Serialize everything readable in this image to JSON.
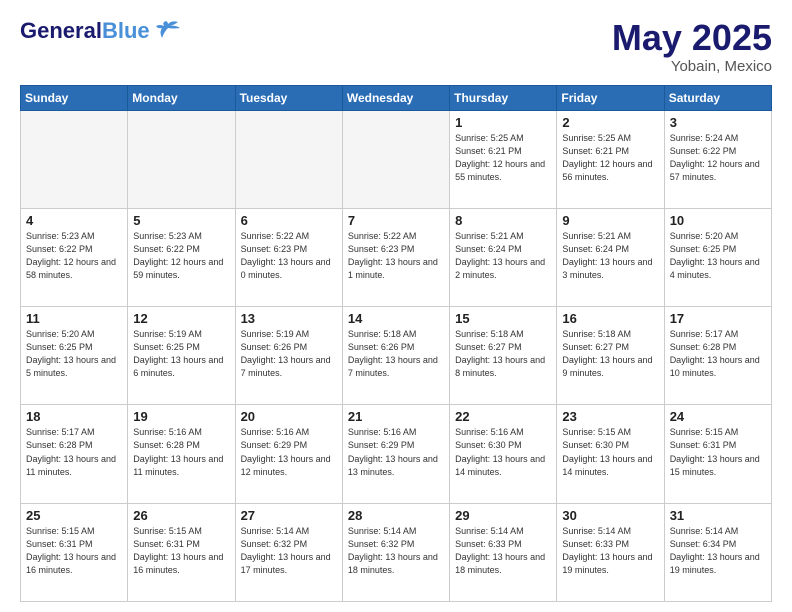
{
  "header": {
    "logo_line1a": "General",
    "logo_line1b": "Blue",
    "main_title": "May 2025",
    "subtitle": "Yobain, Mexico"
  },
  "days_of_week": [
    "Sunday",
    "Monday",
    "Tuesday",
    "Wednesday",
    "Thursday",
    "Friday",
    "Saturday"
  ],
  "weeks": [
    [
      {
        "day": "",
        "empty": true
      },
      {
        "day": "",
        "empty": true
      },
      {
        "day": "",
        "empty": true
      },
      {
        "day": "",
        "empty": true
      },
      {
        "day": "1",
        "sunrise": "5:25 AM",
        "sunset": "6:21 PM",
        "daylight": "12 hours and 55 minutes."
      },
      {
        "day": "2",
        "sunrise": "5:25 AM",
        "sunset": "6:21 PM",
        "daylight": "12 hours and 56 minutes."
      },
      {
        "day": "3",
        "sunrise": "5:24 AM",
        "sunset": "6:22 PM",
        "daylight": "12 hours and 57 minutes."
      }
    ],
    [
      {
        "day": "4",
        "sunrise": "5:23 AM",
        "sunset": "6:22 PM",
        "daylight": "12 hours and 58 minutes."
      },
      {
        "day": "5",
        "sunrise": "5:23 AM",
        "sunset": "6:22 PM",
        "daylight": "12 hours and 59 minutes."
      },
      {
        "day": "6",
        "sunrise": "5:22 AM",
        "sunset": "6:23 PM",
        "daylight": "13 hours and 0 minutes."
      },
      {
        "day": "7",
        "sunrise": "5:22 AM",
        "sunset": "6:23 PM",
        "daylight": "13 hours and 1 minute."
      },
      {
        "day": "8",
        "sunrise": "5:21 AM",
        "sunset": "6:24 PM",
        "daylight": "13 hours and 2 minutes."
      },
      {
        "day": "9",
        "sunrise": "5:21 AM",
        "sunset": "6:24 PM",
        "daylight": "13 hours and 3 minutes."
      },
      {
        "day": "10",
        "sunrise": "5:20 AM",
        "sunset": "6:25 PM",
        "daylight": "13 hours and 4 minutes."
      }
    ],
    [
      {
        "day": "11",
        "sunrise": "5:20 AM",
        "sunset": "6:25 PM",
        "daylight": "13 hours and 5 minutes."
      },
      {
        "day": "12",
        "sunrise": "5:19 AM",
        "sunset": "6:25 PM",
        "daylight": "13 hours and 6 minutes."
      },
      {
        "day": "13",
        "sunrise": "5:19 AM",
        "sunset": "6:26 PM",
        "daylight": "13 hours and 7 minutes."
      },
      {
        "day": "14",
        "sunrise": "5:18 AM",
        "sunset": "6:26 PM",
        "daylight": "13 hours and 7 minutes."
      },
      {
        "day": "15",
        "sunrise": "5:18 AM",
        "sunset": "6:27 PM",
        "daylight": "13 hours and 8 minutes."
      },
      {
        "day": "16",
        "sunrise": "5:18 AM",
        "sunset": "6:27 PM",
        "daylight": "13 hours and 9 minutes."
      },
      {
        "day": "17",
        "sunrise": "5:17 AM",
        "sunset": "6:28 PM",
        "daylight": "13 hours and 10 minutes."
      }
    ],
    [
      {
        "day": "18",
        "sunrise": "5:17 AM",
        "sunset": "6:28 PM",
        "daylight": "13 hours and 11 minutes."
      },
      {
        "day": "19",
        "sunrise": "5:16 AM",
        "sunset": "6:28 PM",
        "daylight": "13 hours and 11 minutes."
      },
      {
        "day": "20",
        "sunrise": "5:16 AM",
        "sunset": "6:29 PM",
        "daylight": "13 hours and 12 minutes."
      },
      {
        "day": "21",
        "sunrise": "5:16 AM",
        "sunset": "6:29 PM",
        "daylight": "13 hours and 13 minutes."
      },
      {
        "day": "22",
        "sunrise": "5:16 AM",
        "sunset": "6:30 PM",
        "daylight": "13 hours and 14 minutes."
      },
      {
        "day": "23",
        "sunrise": "5:15 AM",
        "sunset": "6:30 PM",
        "daylight": "13 hours and 14 minutes."
      },
      {
        "day": "24",
        "sunrise": "5:15 AM",
        "sunset": "6:31 PM",
        "daylight": "13 hours and 15 minutes."
      }
    ],
    [
      {
        "day": "25",
        "sunrise": "5:15 AM",
        "sunset": "6:31 PM",
        "daylight": "13 hours and 16 minutes."
      },
      {
        "day": "26",
        "sunrise": "5:15 AM",
        "sunset": "6:31 PM",
        "daylight": "13 hours and 16 minutes."
      },
      {
        "day": "27",
        "sunrise": "5:14 AM",
        "sunset": "6:32 PM",
        "daylight": "13 hours and 17 minutes."
      },
      {
        "day": "28",
        "sunrise": "5:14 AM",
        "sunset": "6:32 PM",
        "daylight": "13 hours and 18 minutes."
      },
      {
        "day": "29",
        "sunrise": "5:14 AM",
        "sunset": "6:33 PM",
        "daylight": "13 hours and 18 minutes."
      },
      {
        "day": "30",
        "sunrise": "5:14 AM",
        "sunset": "6:33 PM",
        "daylight": "13 hours and 19 minutes."
      },
      {
        "day": "31",
        "sunrise": "5:14 AM",
        "sunset": "6:34 PM",
        "daylight": "13 hours and 19 minutes."
      }
    ]
  ]
}
